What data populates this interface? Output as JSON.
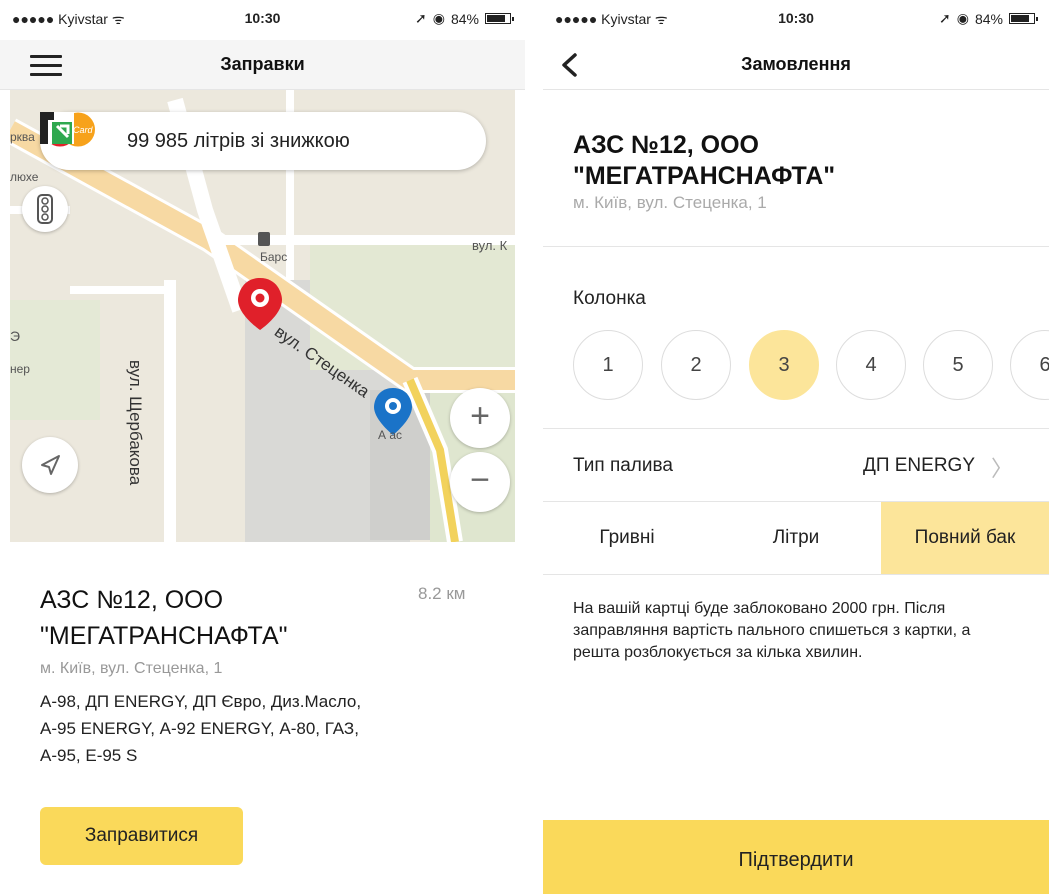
{
  "left": {
    "status": {
      "carrier": "●●●●● Kyivstar ᯤ",
      "time": "10:30",
      "battery": "84%"
    },
    "title": "Заправки",
    "map": {
      "promo_text": "99 985 літрів зі знижкою",
      "mastercard_text": "MasterCard",
      "zoom_in": "+",
      "zoom_out": "−",
      "labels": {
        "pin_label": "Барс",
        "street_stetsenka": "вул. Стеценка",
        "street_sherbakova": "вул. Щербакова",
        "street_k": "вул. К",
        "atlas": "А    ас",
        "edge_1": "рква",
        "edge_2": "люхе",
        "edge_3": "нер",
        "edge_4": "Э"
      }
    },
    "station": {
      "name": "АЗС №12, ООО \"МЕГАТРАНСНАФТА\"",
      "distance": "8.2 км",
      "address": "м. Київ, вул. Стеценка, 1",
      "fuels": "А-98, ДП ENERGY, ДП Євро, Диз.Масло, А-95 ENERGY, А-92 ENERGY, А-80, ГАЗ, А-95, Е-95 S"
    },
    "refuel_button": "Заправитися"
  },
  "right": {
    "status": {
      "carrier": "●●●●● Kyivstar ᯤ",
      "time": "10:30",
      "battery": "84%"
    },
    "title": "Замовлення",
    "station_name": "АЗС №12, ООО \"МЕГАТРАНСНАФТА\"",
    "station_address": "м. Київ, вул. Стеценка, 1",
    "column_label": "Колонка",
    "pumps": [
      "1",
      "2",
      "3",
      "4",
      "5",
      "6"
    ],
    "selected_pump": "3",
    "fuel_type_label": "Тип палива",
    "fuel_type_value": "ДП ENERGY",
    "segments": [
      "Гривні",
      "Літри",
      "Повний бак"
    ],
    "selected_segment": "Повний бак",
    "info_text": "На вашій картці буде заблоковано 2000 грн. Після заправляння вартість пального спишеться з картки, а решта розблокується за кілька хвилин.",
    "confirm_button": "Підтвердити"
  },
  "colors": {
    "accent": "#fad95a",
    "selected": "#fce59a",
    "pin_red": "#e0202a",
    "pin_blue": "#1a73c8"
  }
}
